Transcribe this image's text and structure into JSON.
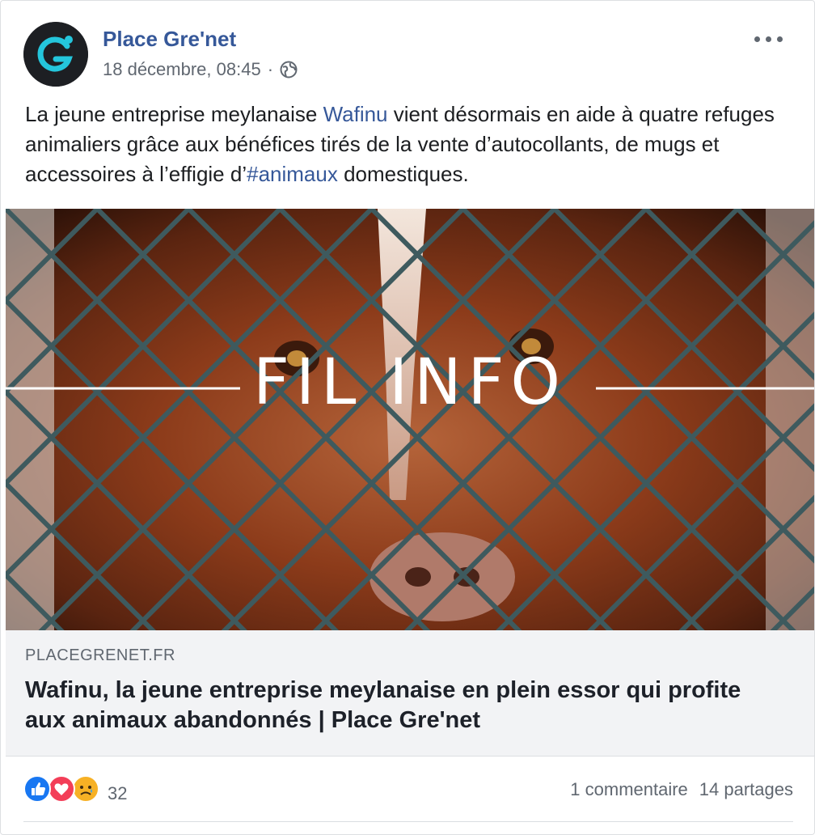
{
  "post": {
    "page_name": "Place Gre'net",
    "timestamp": "18 décembre, 08:45",
    "separator": "·",
    "privacy_icon": "globe-icon",
    "more_icon": "more-options-icon",
    "text": {
      "part1": "La jeune entreprise meylanaise ",
      "link1": "Wafinu",
      "part2": " vient désormais en aide à quatre refuges animaliers grâce aux bénéfices tirés de la vente d’autocollants, de mugs et accessoires à l’effigie d’",
      "hashtag": "#animaux",
      "part3": " domestiques."
    },
    "image": {
      "overlay_text": "FIL INFO"
    },
    "link_preview": {
      "domain": "PLACEGRENET.FR",
      "title": "Wafinu, la jeune entreprise meylanaise en plein essor qui profite aux animaux abandonnés | Place Gre'net"
    },
    "reactions": {
      "icons": [
        "like-icon",
        "love-icon",
        "sad-icon"
      ],
      "count": "32"
    },
    "comments": "1 commentaire",
    "shares": "14 partages"
  },
  "colors": {
    "link": "#365899",
    "secondary_text": "#606770",
    "card_bg": "#f2f3f5",
    "like": "#1877f2",
    "love": "#f33e58",
    "sad": "#f7b125"
  }
}
